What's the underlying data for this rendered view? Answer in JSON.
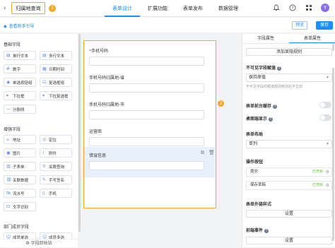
{
  "header": {
    "back_icon": "chevron-left-icon",
    "title": "归属地查询",
    "step_badge": "1",
    "tabs": [
      {
        "label": "表单设计",
        "active": true
      },
      {
        "label": "扩展功能",
        "active": false
      },
      {
        "label": "表单发布",
        "active": false
      },
      {
        "label": "数据管理",
        "active": false
      }
    ],
    "avatar_letter": "Y"
  },
  "subbar": {
    "guide_label": "查看新手引导",
    "preview_label": "预览",
    "save_label": "保存"
  },
  "palette": {
    "basic_title": "基础字段",
    "basic": [
      "单行文本",
      "多行文本",
      "数字",
      "日期时间",
      "单选按钮组",
      "复选框组",
      "下拉框",
      "下拉复选框",
      "分割线"
    ],
    "advanced_title": "增强字段",
    "advanced": [
      "地址",
      "定位",
      "图片",
      "附件",
      "子表单",
      "关联查询",
      "关联数据",
      "手写签名",
      "流水号",
      "手机",
      "文字识别"
    ],
    "member_title": "部门成员字段",
    "member": [
      "成员单选",
      "成员多选"
    ],
    "recycle_label": "字段回收站"
  },
  "form": {
    "step_badge": "2",
    "fields": [
      {
        "label": "手机号码",
        "required": "*"
      },
      {
        "label": "手机号码归属地-省",
        "required": ""
      },
      {
        "label": "手机号码归属地-市",
        "required": ""
      },
      {
        "label": "运营商",
        "required": ""
      },
      {
        "label": "错误信息",
        "required": ""
      }
    ]
  },
  "props": {
    "tabs": [
      {
        "label": "字段属性",
        "active": false
      },
      {
        "label": "表单属性",
        "active": true
      }
    ],
    "add_rule": "添加显隐规则",
    "invisible_title": "不可见字段赋值",
    "invisible_value": "保持原值",
    "invisible_hint": "不可见字段的赋值规则修改后不生效",
    "cache_title": "表单前台缓存",
    "width_title": "桌面端显示",
    "layout_title": "表单布局",
    "layout_value": "单列",
    "ops_title": "操作按钮",
    "ops": [
      {
        "label": "提交",
        "status": "已开启"
      },
      {
        "label": "保存草稿",
        "status": "已开启"
      }
    ],
    "link_style_title": "表单外链样式",
    "setting_label": "设置",
    "submit_event_title": "前端事件",
    "setting_label2": "设置",
    "color_accent": "#1890ff",
    "color_highlight": "#f5a623"
  }
}
